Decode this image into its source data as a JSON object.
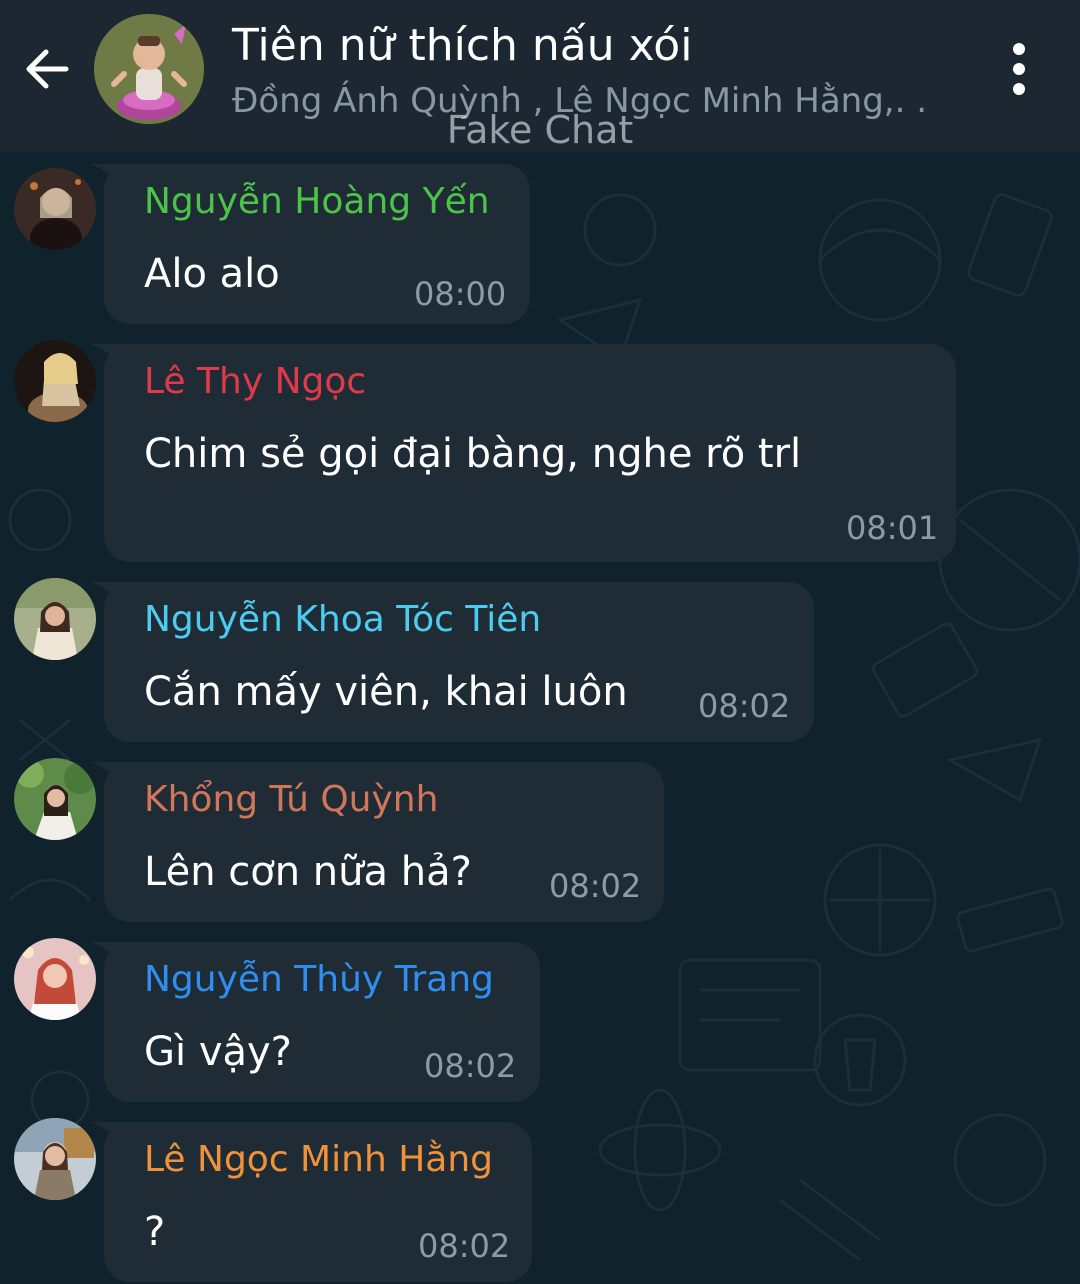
{
  "header": {
    "title": "Tiên nữ thích nấu xói",
    "subtitle": "Đồng Ánh Quỳnh , Lê Ngọc Minh Hằng,. .",
    "watermark": "Fake Chat",
    "back_icon": "arrow-left-icon",
    "menu_icon": "more-vertical-icon"
  },
  "colors": {
    "header_bg": "#1c2731",
    "chat_bg": "#10222b",
    "bubble_bg": "#1f2c36",
    "time": "#8e9aa5"
  },
  "messages": [
    {
      "sender": "Nguyễn Hoàng Yến",
      "sender_color": "#4cc44a",
      "text": "Alo alo",
      "time": "08:00"
    },
    {
      "sender": "Lê Thy Ngọc",
      "sender_color": "#e0394a",
      "text": "Chim sẻ gọi đại bàng, nghe rõ trl",
      "time": "08:01"
    },
    {
      "sender": "Nguyễn Khoa Tóc Tiên",
      "sender_color": "#4dcbf0",
      "text": "Cắn mấy viên, khai luôn",
      "time": "08:02"
    },
    {
      "sender": "Khổng Tú Quỳnh",
      "sender_color": "#d0775a",
      "text": "Lên cơn nữa hả?",
      "time": "08:02"
    },
    {
      "sender": "Nguyễn Thùy Trang",
      "sender_color": "#2f8ef0",
      "text": "Gì vậy?",
      "time": "08:02"
    },
    {
      "sender": "Lê Ngọc Minh Hằng",
      "sender_color": "#f0923a",
      "text": "?",
      "time": "08:02"
    }
  ]
}
